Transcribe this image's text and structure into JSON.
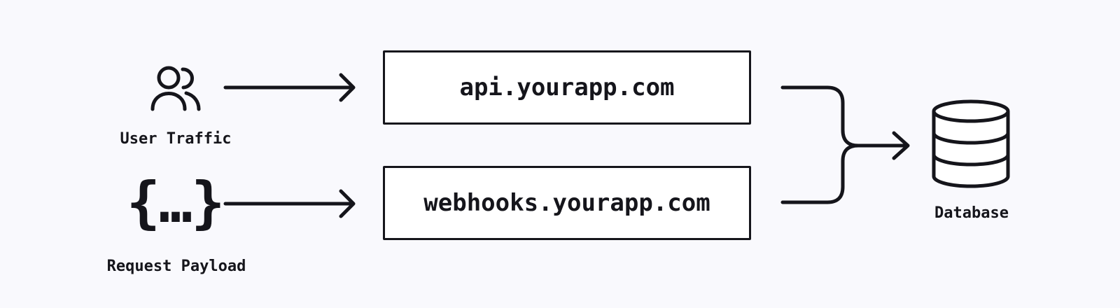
{
  "sources": {
    "user_traffic": {
      "label": "User Traffic",
      "icon": "users-icon"
    },
    "request_payload": {
      "label": "Request Payload",
      "icon": "curly-braces-icon",
      "glyph": "{…}"
    }
  },
  "hosts": [
    {
      "label": "api.yourapp.com"
    },
    {
      "label": "webhooks.yourapp.com"
    }
  ],
  "target": {
    "label": "Database",
    "icon": "database-icon"
  },
  "colors": {
    "background": "#f9f9fd",
    "stroke": "#15151b",
    "box_fill": "#ffffff"
  }
}
